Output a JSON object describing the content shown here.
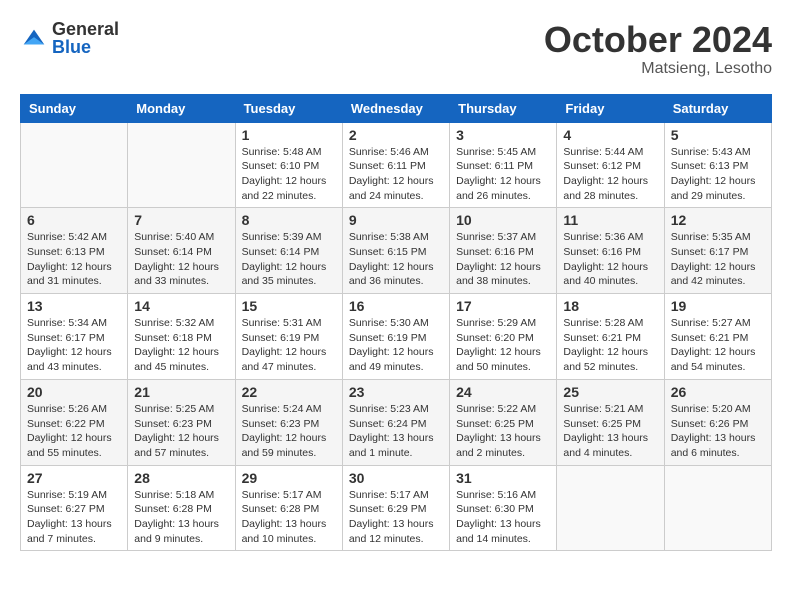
{
  "header": {
    "logo_general": "General",
    "logo_blue": "Blue",
    "title": "October 2024",
    "subtitle": "Matsieng, Lesotho"
  },
  "weekdays": [
    "Sunday",
    "Monday",
    "Tuesday",
    "Wednesday",
    "Thursday",
    "Friday",
    "Saturday"
  ],
  "weeks": [
    [
      {
        "day": "",
        "info": ""
      },
      {
        "day": "",
        "info": ""
      },
      {
        "day": "1",
        "info": "Sunrise: 5:48 AM\nSunset: 6:10 PM\nDaylight: 12 hours and 22 minutes."
      },
      {
        "day": "2",
        "info": "Sunrise: 5:46 AM\nSunset: 6:11 PM\nDaylight: 12 hours and 24 minutes."
      },
      {
        "day": "3",
        "info": "Sunrise: 5:45 AM\nSunset: 6:11 PM\nDaylight: 12 hours and 26 minutes."
      },
      {
        "day": "4",
        "info": "Sunrise: 5:44 AM\nSunset: 6:12 PM\nDaylight: 12 hours and 28 minutes."
      },
      {
        "day": "5",
        "info": "Sunrise: 5:43 AM\nSunset: 6:13 PM\nDaylight: 12 hours and 29 minutes."
      }
    ],
    [
      {
        "day": "6",
        "info": "Sunrise: 5:42 AM\nSunset: 6:13 PM\nDaylight: 12 hours and 31 minutes."
      },
      {
        "day": "7",
        "info": "Sunrise: 5:40 AM\nSunset: 6:14 PM\nDaylight: 12 hours and 33 minutes."
      },
      {
        "day": "8",
        "info": "Sunrise: 5:39 AM\nSunset: 6:14 PM\nDaylight: 12 hours and 35 minutes."
      },
      {
        "day": "9",
        "info": "Sunrise: 5:38 AM\nSunset: 6:15 PM\nDaylight: 12 hours and 36 minutes."
      },
      {
        "day": "10",
        "info": "Sunrise: 5:37 AM\nSunset: 6:16 PM\nDaylight: 12 hours and 38 minutes."
      },
      {
        "day": "11",
        "info": "Sunrise: 5:36 AM\nSunset: 6:16 PM\nDaylight: 12 hours and 40 minutes."
      },
      {
        "day": "12",
        "info": "Sunrise: 5:35 AM\nSunset: 6:17 PM\nDaylight: 12 hours and 42 minutes."
      }
    ],
    [
      {
        "day": "13",
        "info": "Sunrise: 5:34 AM\nSunset: 6:17 PM\nDaylight: 12 hours and 43 minutes."
      },
      {
        "day": "14",
        "info": "Sunrise: 5:32 AM\nSunset: 6:18 PM\nDaylight: 12 hours and 45 minutes."
      },
      {
        "day": "15",
        "info": "Sunrise: 5:31 AM\nSunset: 6:19 PM\nDaylight: 12 hours and 47 minutes."
      },
      {
        "day": "16",
        "info": "Sunrise: 5:30 AM\nSunset: 6:19 PM\nDaylight: 12 hours and 49 minutes."
      },
      {
        "day": "17",
        "info": "Sunrise: 5:29 AM\nSunset: 6:20 PM\nDaylight: 12 hours and 50 minutes."
      },
      {
        "day": "18",
        "info": "Sunrise: 5:28 AM\nSunset: 6:21 PM\nDaylight: 12 hours and 52 minutes."
      },
      {
        "day": "19",
        "info": "Sunrise: 5:27 AM\nSunset: 6:21 PM\nDaylight: 12 hours and 54 minutes."
      }
    ],
    [
      {
        "day": "20",
        "info": "Sunrise: 5:26 AM\nSunset: 6:22 PM\nDaylight: 12 hours and 55 minutes."
      },
      {
        "day": "21",
        "info": "Sunrise: 5:25 AM\nSunset: 6:23 PM\nDaylight: 12 hours and 57 minutes."
      },
      {
        "day": "22",
        "info": "Sunrise: 5:24 AM\nSunset: 6:23 PM\nDaylight: 12 hours and 59 minutes."
      },
      {
        "day": "23",
        "info": "Sunrise: 5:23 AM\nSunset: 6:24 PM\nDaylight: 13 hours and 1 minute."
      },
      {
        "day": "24",
        "info": "Sunrise: 5:22 AM\nSunset: 6:25 PM\nDaylight: 13 hours and 2 minutes."
      },
      {
        "day": "25",
        "info": "Sunrise: 5:21 AM\nSunset: 6:25 PM\nDaylight: 13 hours and 4 minutes."
      },
      {
        "day": "26",
        "info": "Sunrise: 5:20 AM\nSunset: 6:26 PM\nDaylight: 13 hours and 6 minutes."
      }
    ],
    [
      {
        "day": "27",
        "info": "Sunrise: 5:19 AM\nSunset: 6:27 PM\nDaylight: 13 hours and 7 minutes."
      },
      {
        "day": "28",
        "info": "Sunrise: 5:18 AM\nSunset: 6:28 PM\nDaylight: 13 hours and 9 minutes."
      },
      {
        "day": "29",
        "info": "Sunrise: 5:17 AM\nSunset: 6:28 PM\nDaylight: 13 hours and 10 minutes."
      },
      {
        "day": "30",
        "info": "Sunrise: 5:17 AM\nSunset: 6:29 PM\nDaylight: 13 hours and 12 minutes."
      },
      {
        "day": "31",
        "info": "Sunrise: 5:16 AM\nSunset: 6:30 PM\nDaylight: 13 hours and 14 minutes."
      },
      {
        "day": "",
        "info": ""
      },
      {
        "day": "",
        "info": ""
      }
    ]
  ]
}
